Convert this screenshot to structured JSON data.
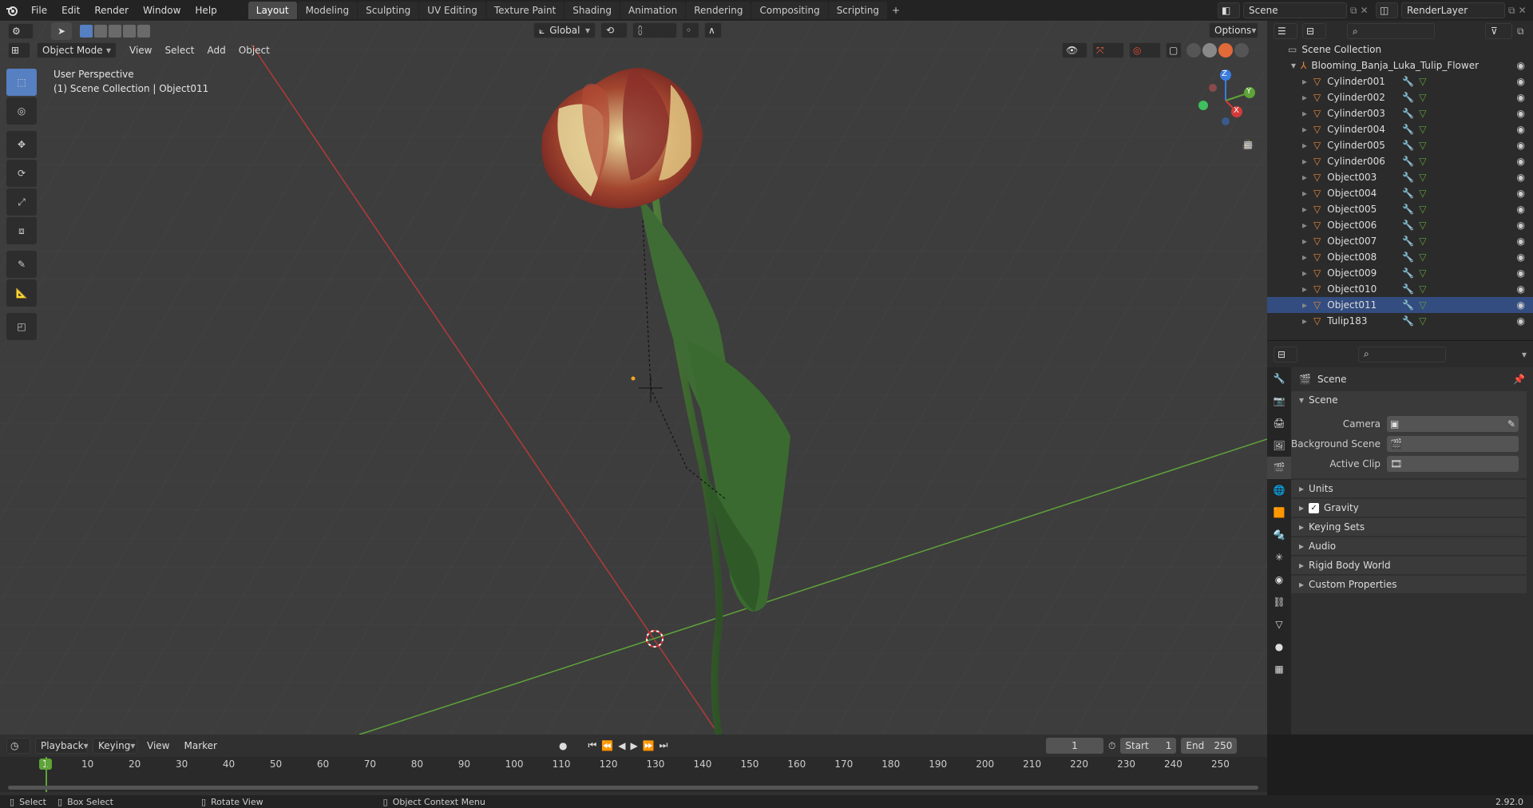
{
  "menus": [
    "File",
    "Edit",
    "Render",
    "Window",
    "Help"
  ],
  "workspaces": [
    "Layout",
    "Modeling",
    "Sculpting",
    "UV Editing",
    "Texture Paint",
    "Shading",
    "Animation",
    "Rendering",
    "Compositing",
    "Scripting"
  ],
  "active_workspace": "Layout",
  "scene_name": "Scene",
  "render_layer": "RenderLayer",
  "viewport": {
    "mode": "Object Mode",
    "header_menus": [
      "View",
      "Select",
      "Add",
      "Object"
    ],
    "transform_orientation": "Global",
    "options_label": "Options",
    "perspective_label": "User Perspective",
    "collection_label": "(1) Scene Collection | Object011"
  },
  "gizmo": {
    "x": "X",
    "y": "Y",
    "z": "Z"
  },
  "outliner": {
    "root": "Scene Collection",
    "collection": "Blooming_Banja_Luka_Tulip_Flower",
    "objects": [
      "Cylinder001",
      "Cylinder002",
      "Cylinder003",
      "Cylinder004",
      "Cylinder005",
      "Cylinder006",
      "Object003",
      "Object004",
      "Object005",
      "Object006",
      "Object007",
      "Object008",
      "Object009",
      "Object010",
      "Object011",
      "Tulip183"
    ],
    "selected": "Object011"
  },
  "properties": {
    "context": "Scene",
    "panel": "Scene",
    "fields": [
      {
        "label": "Camera",
        "value": ""
      },
      {
        "label": "Background Scene",
        "value": ""
      },
      {
        "label": "Active Clip",
        "value": ""
      }
    ],
    "subpanels": [
      "Units",
      "Gravity",
      "Keying Sets",
      "Audio",
      "Rigid Body World",
      "Custom Properties"
    ],
    "gravity_checked": true
  },
  "timeline": {
    "menus": [
      "Playback",
      "Keying",
      "View",
      "Marker"
    ],
    "current_frame": "1",
    "start_label": "Start",
    "start": "1",
    "end_label": "End",
    "end": "250",
    "ticks": [
      "1",
      "10",
      "20",
      "30",
      "40",
      "50",
      "60",
      "70",
      "80",
      "90",
      "100",
      "110",
      "120",
      "130",
      "140",
      "150",
      "160",
      "170",
      "180",
      "190",
      "200",
      "210",
      "220",
      "230",
      "240",
      "250"
    ]
  },
  "statusbar": {
    "select": "Select",
    "box_select": "Box Select",
    "rotate_view": "Rotate View",
    "context_menu": "Object Context Menu",
    "version": "2.92.0"
  },
  "colors": {
    "accent": "#5680c2",
    "x_axis": "#b33a3a",
    "y_axis": "#5fa339",
    "selected_row": "#334d80",
    "object_icon": "#e8873a"
  }
}
